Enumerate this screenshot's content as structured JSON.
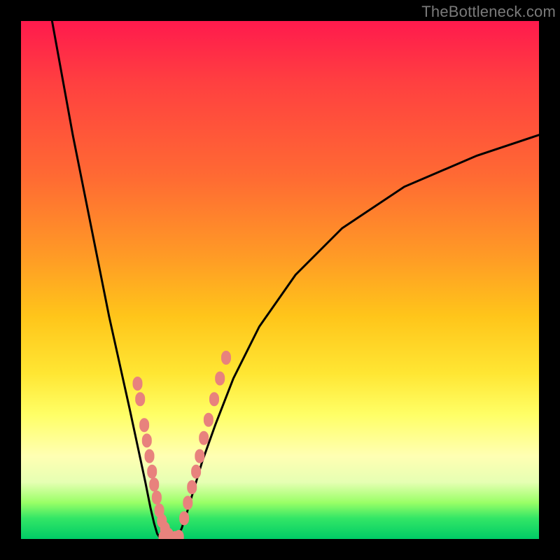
{
  "watermark": "TheBottleneck.com",
  "chart_data": {
    "type": "line",
    "title": "",
    "xlabel": "",
    "ylabel": "",
    "xlim": [
      0,
      100
    ],
    "ylim": [
      0,
      100
    ],
    "note": "Axes unlabeled; values estimated from pixel positions on a 0–100 normalized scale. Y measures height of black curve above bottom edge; x is horizontal position inside plot area. Background gradient encodes a score from red (top, high) to green (bottom, low).",
    "series": [
      {
        "name": "left-branch",
        "x": [
          6,
          10,
          14,
          17,
          19,
          21,
          22.5,
          24,
          25,
          25.7,
          26.3,
          27
        ],
        "y": [
          100,
          78,
          58,
          43,
          34,
          25,
          18,
          11,
          6,
          3,
          1,
          0
        ]
      },
      {
        "name": "right-branch",
        "x": [
          30,
          31,
          32,
          33.5,
          35,
          37.5,
          41,
          46,
          53,
          62,
          74,
          88,
          100
        ],
        "y": [
          0,
          2,
          5,
          10,
          15,
          22,
          31,
          41,
          51,
          60,
          68,
          74,
          78
        ]
      },
      {
        "name": "left-scatter-overlay",
        "x": [
          22.5,
          23.0,
          23.8,
          24.3,
          24.8,
          25.3,
          25.7,
          26.2,
          26.7,
          27.2,
          27.8,
          28.5
        ],
        "y": [
          30.0,
          27.0,
          22.0,
          19.0,
          16.0,
          13.0,
          10.5,
          8.0,
          5.5,
          3.5,
          2.0,
          0.8
        ]
      },
      {
        "name": "right-scatter-overlay",
        "x": [
          31.5,
          32.2,
          33.0,
          33.8,
          34.5,
          35.3,
          36.2,
          37.3,
          38.4,
          39.6
        ],
        "y": [
          4.0,
          7.0,
          10.0,
          13.0,
          16.0,
          19.5,
          23.0,
          27.0,
          31.0,
          35.0
        ]
      },
      {
        "name": "valley-floor-overlay",
        "x": [
          27.5,
          28.2,
          29.0,
          29.8,
          30.5
        ],
        "y": [
          0.3,
          0.2,
          0.2,
          0.2,
          0.4
        ]
      }
    ],
    "gradient_stops": [
      {
        "pos": 0,
        "color": "#ff1a4d"
      },
      {
        "pos": 12,
        "color": "#ff4040"
      },
      {
        "pos": 30,
        "color": "#ff6a33"
      },
      {
        "pos": 45,
        "color": "#ff9926"
      },
      {
        "pos": 57,
        "color": "#ffc51a"
      },
      {
        "pos": 68,
        "color": "#ffe633"
      },
      {
        "pos": 76,
        "color": "#ffff66"
      },
      {
        "pos": 84,
        "color": "#ffffb3"
      },
      {
        "pos": 89,
        "color": "#e6ffb3"
      },
      {
        "pos": 93,
        "color": "#99ff66"
      },
      {
        "pos": 96,
        "color": "#33e666"
      },
      {
        "pos": 100,
        "color": "#00cc66"
      }
    ],
    "marker_color": "#e8827d",
    "curve_color": "#000000"
  }
}
